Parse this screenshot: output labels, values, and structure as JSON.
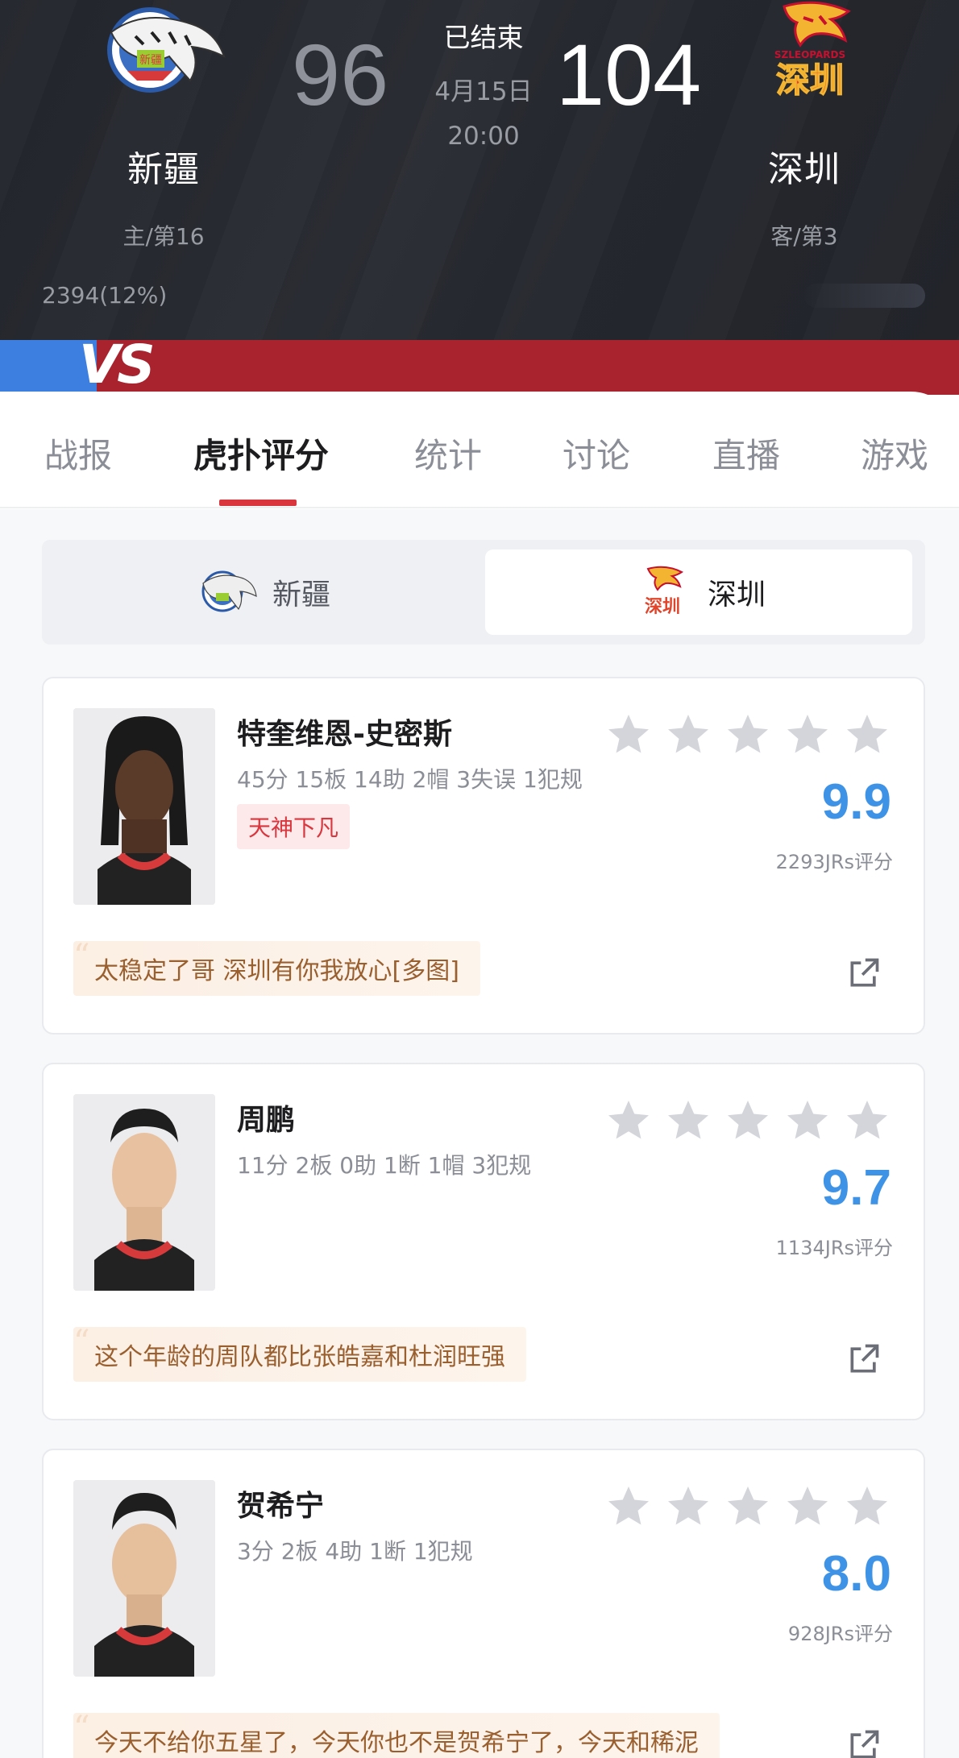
{
  "header": {
    "home": {
      "name": "新疆",
      "rank": "主/第16",
      "score": "96",
      "logo_text": "新疆"
    },
    "away": {
      "name": "深圳",
      "rank": "客/第3",
      "score": "104",
      "logo_text": "深圳"
    },
    "status": "已结束",
    "date": "4月15日",
    "time": "20:00",
    "support_left": "2394(12%)",
    "vs": "VS"
  },
  "tabs": [
    {
      "label": "战报"
    },
    {
      "label": "虎扑评分"
    },
    {
      "label": "统计"
    },
    {
      "label": "讨论"
    },
    {
      "label": "直播"
    },
    {
      "label": "游戏"
    }
  ],
  "team_switch": {
    "home_label": "新疆",
    "away_label": "深圳"
  },
  "players": [
    {
      "name": "特奎维恩-史密斯",
      "stats": "45分 15板 14助 2帽 3失误 1犯规",
      "tag": "天神下凡",
      "rating": "9.9",
      "votes": "2293JRs评分",
      "comment": "太稳定了哥 深圳有你我放心[多图]"
    },
    {
      "name": "周鹏",
      "stats": "11分 2板 0助 1断 1帽 3犯规",
      "tag": "",
      "rating": "9.7",
      "votes": "1134JRs评分",
      "comment": "这个年龄的周队都比张皓嘉和杜润旺强"
    },
    {
      "name": "贺希宁",
      "stats": "3分 2板 4助 1断 1犯规",
      "tag": "",
      "rating": "8.0",
      "votes": "928JRs评分",
      "comment": "今天不给你五星了，今天你也不是贺希宁了，今天和稀泥"
    }
  ],
  "colors": {
    "accent_red": "#d9363e",
    "rating_blue": "#3f93e6",
    "vs_blue": "#3d7fe0",
    "vs_red": "#a8232e"
  }
}
